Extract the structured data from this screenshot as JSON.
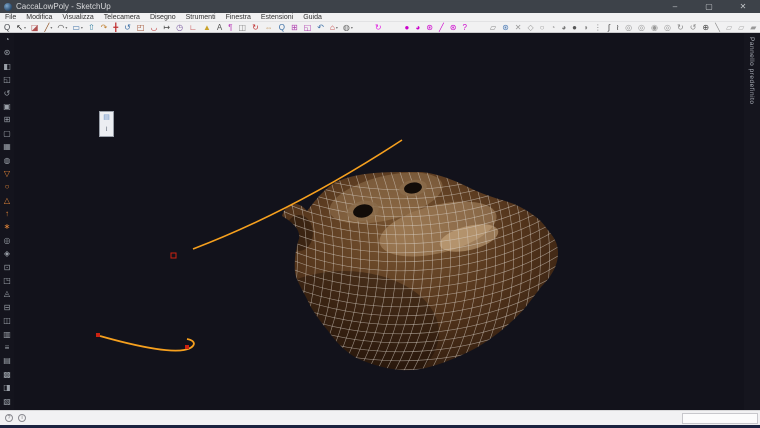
{
  "window": {
    "title": "CaccaLowPoly - SketchUp",
    "minimize": "–",
    "maximize": "▢",
    "close": "✕"
  },
  "menu_bar": {
    "items": [
      {
        "label": "File"
      },
      {
        "label": "Modifica"
      },
      {
        "label": "Visualizza"
      },
      {
        "label": "Telecamera"
      },
      {
        "label": "Disegno"
      },
      {
        "label": "Strumenti"
      },
      {
        "label": "Finestra"
      },
      {
        "label": "Estensioni"
      },
      {
        "label": "Guida"
      }
    ]
  },
  "toolbar": {
    "icons": [
      {
        "n": "select-tool-icon",
        "g": "Q",
        "c": "#44474c"
      },
      {
        "n": "arrow-tool-icon",
        "g": "↖",
        "c": "#222",
        "caret": "▾"
      },
      {
        "n": "eraser-tool-icon",
        "g": "◪",
        "c": "#b05050",
        "gap": 3
      },
      {
        "n": "pencil-tool-icon",
        "g": "╱",
        "c": "#8a4a1a",
        "caret": "▾"
      },
      {
        "n": "arc-tool-icon",
        "g": "◠",
        "c": "#444",
        "caret": "▾"
      },
      {
        "n": "rectangle-tool-icon",
        "g": "▭",
        "c": "#3a6ea5",
        "caret": "▾"
      },
      {
        "n": "pushpull-tool-icon",
        "g": "⇧",
        "c": "#2e7d9e",
        "gap": 3
      },
      {
        "n": "followme-tool-icon",
        "g": "↷",
        "c": "#c08030"
      },
      {
        "n": "move-tool-icon",
        "g": "╋",
        "c": "#c03030"
      },
      {
        "n": "rotate-tool-icon",
        "g": "↺",
        "c": "#3a6ea5"
      },
      {
        "n": "scale-tool-icon",
        "g": "◰",
        "c": "#a05030"
      },
      {
        "n": "offset-tool-icon",
        "g": "◡",
        "c": "#c04040"
      },
      {
        "n": "tape-measure-icon",
        "g": "↦",
        "c": "#444",
        "gap": 3
      },
      {
        "n": "protractor-icon",
        "g": "◷",
        "c": "#7a5aa0"
      },
      {
        "n": "axes-icon",
        "g": "∟",
        "c": "#c03030"
      },
      {
        "n": "dimension-icon",
        "g": "▲",
        "c": "#c9a22a"
      },
      {
        "n": "text-tool-icon",
        "g": "A",
        "c": "#555"
      },
      {
        "n": "3dtext-tool-icon",
        "g": "¶",
        "c": "#c050c0"
      },
      {
        "n": "section-plane-icon",
        "g": "◫",
        "c": "#888",
        "gap": 3
      },
      {
        "n": "orbit-tool-icon",
        "g": "↻",
        "c": "#c03030"
      },
      {
        "n": "pan-tool-icon",
        "g": "⇔",
        "c": "#c08f4f"
      },
      {
        "n": "zoom-tool-icon",
        "g": "Q",
        "c": "#3a6ea5"
      },
      {
        "n": "zoom-window-icon",
        "g": "⊞",
        "c": "#b040b0"
      },
      {
        "n": "zoom-extents-icon",
        "g": "◱",
        "c": "#b040b0"
      },
      {
        "n": "previous-view-icon",
        "g": "↶",
        "c": "#3a6ea5"
      },
      {
        "n": "views-icon",
        "g": "⌂",
        "c": "#c03030",
        "caret": "▾"
      },
      {
        "n": "styles-icon",
        "g": "◍",
        "c": "#666",
        "caret": "▾",
        "gap": 3
      },
      {
        "n": "component-spin-icon",
        "g": "↻",
        "c": "#e020e0",
        "gap": 20
      },
      {
        "n": "plugin-sphere-icon",
        "g": "●",
        "c": "#cc00cc",
        "gap": 20
      },
      {
        "n": "plugin-pie-icon",
        "g": "◕",
        "c": "#cc00cc"
      },
      {
        "n": "plugin-wheel-icon",
        "g": "⊛",
        "c": "#cc00cc"
      },
      {
        "n": "plugin-pencil-icon",
        "g": "╱",
        "c": "#cc00cc"
      },
      {
        "n": "plugin-gear-icon",
        "g": "⊛",
        "c": "#cc00cc"
      },
      {
        "n": "plugin-help-icon",
        "g": "?",
        "c": "#cc00cc"
      },
      {
        "n": "folder-icon",
        "g": "▱",
        "c": "#888",
        "gap": 20
      },
      {
        "n": "settings-gear-icon",
        "g": "⊛",
        "c": "#4a7ab5"
      },
      {
        "n": "delete-icon",
        "g": "✕",
        "c": "#999"
      },
      {
        "n": "diamond-icon",
        "g": "◇",
        "c": "#999"
      },
      {
        "n": "droplet-outline-icon",
        "g": "○",
        "c": "#999"
      },
      {
        "n": "droplet-quarter-icon",
        "g": "◔",
        "c": "#aaa"
      },
      {
        "n": "droplet-three-quarter-icon",
        "g": "◕",
        "c": "#777"
      },
      {
        "n": "droplet-filled-icon",
        "g": "●",
        "c": "#555"
      },
      {
        "n": "droplet-half-icon",
        "g": "◑",
        "c": "#888"
      },
      {
        "n": "dots-icon",
        "g": "⋮",
        "c": "#888"
      },
      {
        "n": "curve-pencil-icon",
        "g": "∫",
        "c": "#444",
        "gap": 3
      },
      {
        "n": "wave-pencil-icon",
        "g": "≀",
        "c": "#444"
      },
      {
        "n": "ring-1-icon",
        "g": "◎",
        "c": "#999"
      },
      {
        "n": "ring-2-icon",
        "g": "◎",
        "c": "#999"
      },
      {
        "n": "ring-dot-icon",
        "g": "◉",
        "c": "#999"
      },
      {
        "n": "ring-3-icon",
        "g": "◎",
        "c": "#999"
      },
      {
        "n": "spin-cw-icon",
        "g": "↻",
        "c": "#888"
      },
      {
        "n": "spin-ccw-icon",
        "g": "↺",
        "c": "#888"
      },
      {
        "n": "add-circle-icon",
        "g": "⊕",
        "c": "#444"
      },
      {
        "n": "line-segment-icon",
        "g": "╲",
        "c": "#888"
      },
      {
        "n": "plane-1-icon",
        "g": "▱",
        "c": "#aaa"
      },
      {
        "n": "plane-2-icon",
        "g": "▱",
        "c": "#aaa"
      },
      {
        "n": "plane-filled-icon",
        "g": "▰",
        "c": "#999"
      },
      {
        "n": "plane-blue-icon",
        "g": "▰",
        "c": "#5b9bd5"
      },
      {
        "n": "stack-icon",
        "g": "≋",
        "c": "#888"
      },
      {
        "n": "document-icon",
        "g": "▯",
        "c": "#777",
        "gap": 12
      },
      {
        "n": "sign-in-person-icon",
        "g": "☻",
        "c": "#3b7fc4"
      }
    ]
  },
  "left_toolbar": {
    "icons": [
      {
        "n": "lt-orbit-icon",
        "g": "◔",
        "c": "#9aa0a8"
      },
      {
        "n": "lt-gear-icon",
        "g": "⊛",
        "c": "#9aa0a8"
      },
      {
        "n": "lt-halfsquare-icon",
        "g": "◧",
        "c": "#9aa0a8"
      },
      {
        "n": "lt-corner-icon",
        "g": "◱",
        "c": "#9aa0a8"
      },
      {
        "n": "lt-undo-icon",
        "g": "↺",
        "c": "#9aa0a8"
      },
      {
        "n": "lt-fill-icon",
        "g": "▣",
        "c": "#9aa0a8"
      },
      {
        "n": "lt-grid-icon",
        "g": "⊞",
        "c": "#9aa0a8"
      },
      {
        "n": "lt-square-icon",
        "g": "▢",
        "c": "#9aa0a8"
      },
      {
        "n": "lt-mesh-icon",
        "g": "▦",
        "c": "#9aa0a8"
      },
      {
        "n": "lt-circle-dot-icon",
        "g": "◍",
        "c": "#9aa0a8"
      },
      {
        "n": "lt-funnel-icon",
        "g": "▽",
        "c": "#e08438"
      },
      {
        "n": "lt-ring-icon",
        "g": "○",
        "c": "#e08438"
      },
      {
        "n": "lt-triangle-icon",
        "g": "△",
        "c": "#e08438"
      },
      {
        "n": "lt-arrow-up-icon",
        "g": "↑",
        "c": "#e08438"
      },
      {
        "n": "lt-asterisk-icon",
        "g": "∗",
        "c": "#e08438"
      },
      {
        "n": "lt-target-icon",
        "g": "◎",
        "c": "#9aa0a8"
      },
      {
        "n": "lt-gem-icon",
        "g": "◈",
        "c": "#9aa0a8"
      },
      {
        "n": "lt-boxdot-icon",
        "g": "⊡",
        "c": "#9aa0a8"
      },
      {
        "n": "lt-quadrant-icon",
        "g": "◳",
        "c": "#9aa0a8"
      },
      {
        "n": "lt-tri-dot-icon",
        "g": "◬",
        "c": "#9aa0a8"
      },
      {
        "n": "lt-minusbox-icon",
        "g": "⊟",
        "c": "#9aa0a8"
      },
      {
        "n": "lt-split-icon",
        "g": "◫",
        "c": "#9aa0a8"
      },
      {
        "n": "lt-lines-icon",
        "g": "▥",
        "c": "#9aa0a8"
      },
      {
        "n": "lt-menu-icon",
        "g": "≡",
        "c": "#9aa0a8"
      },
      {
        "n": "lt-rows-icon",
        "g": "▤",
        "c": "#9aa0a8"
      },
      {
        "n": "lt-hatch-icon",
        "g": "▩",
        "c": "#9aa0a8"
      },
      {
        "n": "lt-halfbottom-icon",
        "g": "◨",
        "c": "#9aa0a8"
      },
      {
        "n": "lt-diag-icon",
        "g": "▧",
        "c": "#9aa0a8"
      }
    ]
  },
  "mini_palette": {
    "buttons": [
      {
        "n": "bezier-image-icon",
        "g": "▤",
        "c": "#6a92c8"
      },
      {
        "n": "bezier-curve-icon",
        "g": "≀",
        "c": "#5a6270"
      }
    ]
  },
  "right_tray": {
    "label": "Pannello predefinito"
  },
  "status_bar": {
    "icons": [
      {
        "n": "geolocation-icon",
        "g": "?"
      },
      {
        "n": "info-icon",
        "g": "i"
      }
    ],
    "measure_value": "",
    "measure_placeholder": ""
  },
  "canvas": {
    "background": "#12121b",
    "model_name": "low-poly-mesh-blob",
    "wire_color": "#d9d0c6",
    "body_inner": "#7a5632",
    "body_mid": "#54351c",
    "body_edge": "#2d1a0d",
    "eye_color": "#120c08",
    "eye_ring": "#8a6b4a",
    "highlight": "#c9a87e",
    "guide_orange": "#f6a01e",
    "marker_red": "#cc2211"
  }
}
